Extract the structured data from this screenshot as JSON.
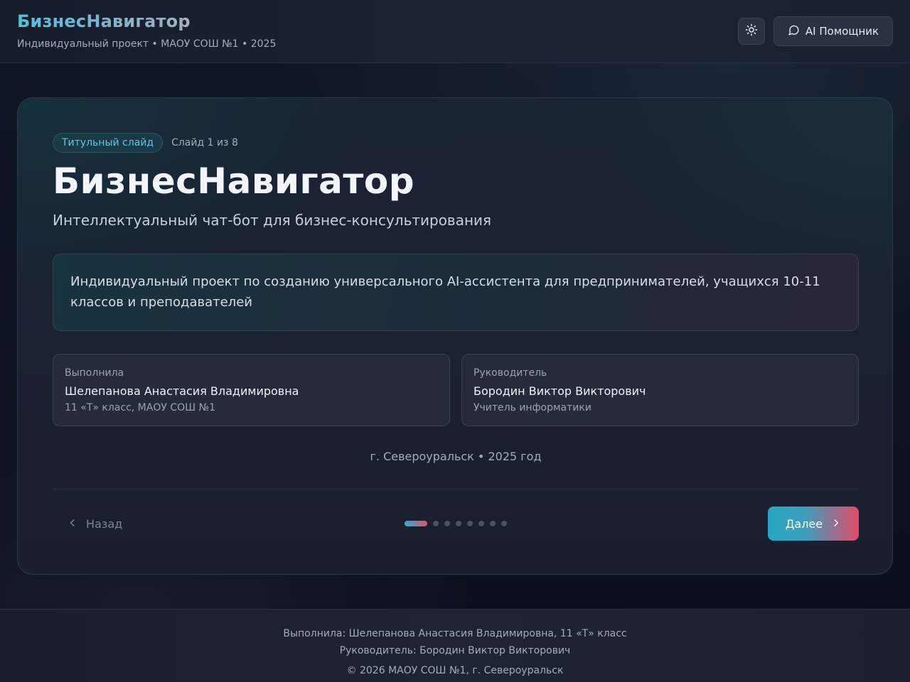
{
  "header": {
    "title": "БизнесНавигатор",
    "subtitle": "Индивидуальный проект • МАОУ СОШ №1 • 2025",
    "theme_icon": "sun-icon",
    "ai_button_label": "AI Помощник",
    "ai_icon": "chat-bubble-icon"
  },
  "slide": {
    "badge": "Титульный слайд",
    "counter": "Слайд 1 из 8",
    "title": "БизнесНавигатор",
    "subtitle": "Интеллектуальный чат-бот для бизнес-консультирования",
    "description": "Индивидуальный проект по созданию универсального AI-ассистента для предпринимателей, учащихся 10-11 классов и преподавателей",
    "author": {
      "label": "Выполнила",
      "name": "Шелепанова Анастасия Владимировна",
      "meta": "11 «Т» класс, МАОУ СОШ №1"
    },
    "supervisor": {
      "label": "Руководитель",
      "name": "Бородин Виктор Викторович",
      "meta": "Учитель информатики"
    },
    "place": "г. Североуральск • 2025 год"
  },
  "navigation": {
    "back_label": "Назад",
    "next_label": "Далее",
    "current_slide": 1,
    "total_slides": 8
  },
  "footer": {
    "line1": "Выполнила: Шелепанова Анастасия Владимировна, 11 «Т» класс",
    "line2": "Руководитель: Бородин Виктор Викторович",
    "line3": "© 2026 МАОУ СОШ №1, г. Североуральск"
  },
  "colors": {
    "accent_cyan": "#2bb0cf",
    "accent_pink": "#e0526a",
    "background": "#0c1220"
  }
}
